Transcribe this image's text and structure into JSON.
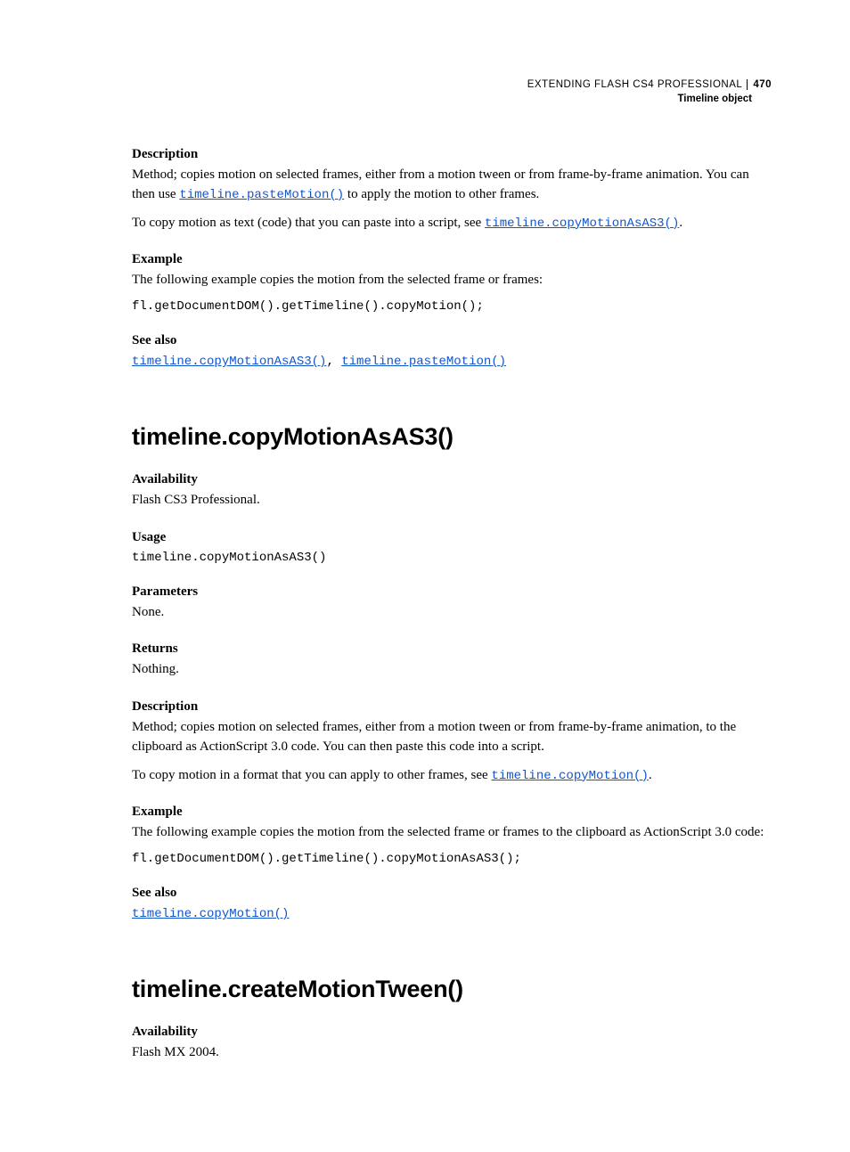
{
  "header": {
    "doc_title": "EXTENDING FLASH CS4 PROFESSIONAL",
    "page_num": "470",
    "section": "Timeline object"
  },
  "part1": {
    "desc_head": "Description",
    "desc_p1a": "Method; copies motion on selected frames, either from a motion tween or from frame-by-frame animation. You can then use ",
    "desc_link1": "timeline.pasteMotion()",
    "desc_p1b": " to apply the motion to other frames.",
    "desc_p2a": "To copy motion as text (code) that you can paste into a script, see ",
    "desc_link2": "timeline.copyMotionAsAS3()",
    "desc_p2b": ".",
    "ex_head": "Example",
    "ex_p": "The following example copies the motion from the selected frame or frames:",
    "ex_code": "fl.getDocumentDOM().getTimeline().copyMotion();",
    "sa_head": "See also",
    "sa_link1": "timeline.copyMotionAsAS3()",
    "sa_sep": ", ",
    "sa_link2": "timeline.pasteMotion()"
  },
  "sec2": {
    "title": "timeline.copyMotionAsAS3()",
    "avail_head": "Availability",
    "avail_p": "Flash CS3 Professional.",
    "usage_head": "Usage",
    "usage_code": "timeline.copyMotionAsAS3()",
    "param_head": "Parameters",
    "param_p": "None.",
    "ret_head": "Returns",
    "ret_p": "Nothing.",
    "desc_head": "Description",
    "desc_p1": "Method; copies motion on selected frames, either from a motion tween or from frame-by-frame animation, to the clipboard as ActionScript 3.0 code. You can then paste this code into a script.",
    "desc_p2a": "To copy motion in a format that you can apply to other frames, see ",
    "desc_link": "timeline.copyMotion()",
    "desc_p2b": ".",
    "ex_head": "Example",
    "ex_p": "The following example copies the motion from the selected frame or frames to the clipboard as ActionScript 3.0 code:",
    "ex_code": "fl.getDocumentDOM().getTimeline().copyMotionAsAS3();",
    "sa_head": "See also",
    "sa_link": "timeline.copyMotion()"
  },
  "sec3": {
    "title": "timeline.createMotionTween()",
    "avail_head": "Availability",
    "avail_p": "Flash MX 2004."
  }
}
